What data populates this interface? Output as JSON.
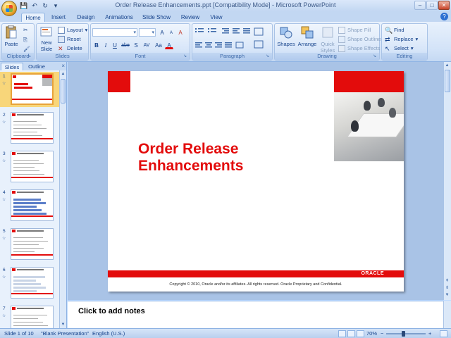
{
  "window": {
    "title": "Order Release Enhancements.ppt [Compatibility Mode] - Microsoft PowerPoint",
    "controls": [
      "–",
      "□",
      "✕"
    ]
  },
  "qat": {
    "save": "💾",
    "undo": "↶",
    "redo": "↻",
    "more": "▾"
  },
  "tabs": [
    "Home",
    "Insert",
    "Design",
    "Animations",
    "Slide Show",
    "Review",
    "View"
  ],
  "active_tab": "Home",
  "help": "?",
  "ribbon": {
    "clipboard": {
      "label": "Clipboard",
      "paste": "Paste",
      "cut": "✂",
      "copy": "⎘",
      "format_painter": "🖌"
    },
    "slides": {
      "label": "Slides",
      "new_slide": "New Slide",
      "layout": "Layout",
      "reset": "Reset",
      "delete": "Delete"
    },
    "font": {
      "label": "Font",
      "font_name": "",
      "font_size": "",
      "grow": "A",
      "shrink": "A",
      "clear": "A",
      "bold": "B",
      "italic": "I",
      "underline": "U",
      "strike": "abe",
      "shadow": "S",
      "spacing": "AV",
      "case": "Aa",
      "color": "A"
    },
    "paragraph": {
      "label": "Paragraph"
    },
    "drawing": {
      "label": "Drawing",
      "shapes": "Shapes",
      "arrange": "Arrange",
      "quick_styles": "Quick Styles",
      "shape_fill": "Shape Fill",
      "shape_outline": "Shape Outline",
      "shape_effects": "Shape Effects"
    },
    "editing": {
      "label": "Editing",
      "find": "Find",
      "replace": "Replace",
      "select": "Select"
    }
  },
  "slide_panel": {
    "tabs": [
      "Slides",
      "Outline"
    ],
    "active_tab": "Slides",
    "close": "×",
    "thumbnails": [
      {
        "num": "1",
        "title": "Order Release Enhancements",
        "selected": true
      },
      {
        "num": "2",
        "title": "Order Release Enhancements: Introduction",
        "selected": false
      },
      {
        "num": "3",
        "title": "Order Release Enhancements: Order Release Flow",
        "selected": false
      },
      {
        "num": "4",
        "title": "Order Release Enhancements: Overview",
        "selected": false
      },
      {
        "num": "5",
        "title": "Order Release Enhancements: Order Release Details",
        "selected": false
      },
      {
        "num": "6",
        "title": "Order Release Enhancements: Order Release Screen",
        "selected": false
      },
      {
        "num": "7",
        "title": "Order Release Enhancements: Order Release Manager",
        "selected": false
      }
    ]
  },
  "slide": {
    "title": "Order Release\nEnhancements",
    "logo_text": "ORACLE",
    "footer": "Copyright © 2010, Oracle and/or its affiliates. All rights reserved.   Oracle Proprietary and Confidential.",
    "accent_color": "#e30c0c"
  },
  "notes": {
    "placeholder": "Click to add notes"
  },
  "status": {
    "slide_info": "Slide 1 of 10",
    "theme": "\"Blank Presentation\"",
    "language": "English (U.S.)",
    "zoom": "70%",
    "zoom_out": "−",
    "zoom_in": "+"
  }
}
